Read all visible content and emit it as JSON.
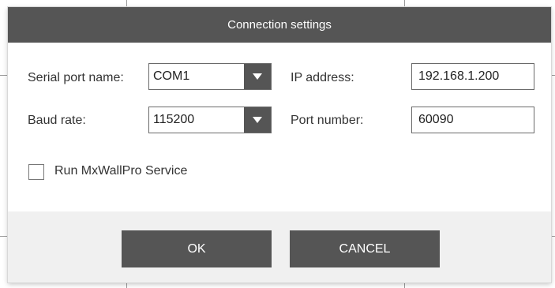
{
  "dialog": {
    "title": "Connection settings"
  },
  "serial": {
    "port_label": "Serial port name:",
    "port_value": "COM1",
    "baud_label": "Baud rate:",
    "baud_value": "115200"
  },
  "network": {
    "ip_label": "IP address:",
    "ip_value": "192.168.1.200",
    "port_label": "Port number:",
    "port_value": "60090"
  },
  "service": {
    "label": "Run MxWallPro Service",
    "checked": false
  },
  "buttons": {
    "ok": "OK",
    "cancel": "CANCEL"
  },
  "icons": {
    "dropdown": "chevron-down-icon"
  },
  "colors": {
    "titlebar": "#555555",
    "button": "#555555",
    "footer": "#f0f0f0"
  }
}
